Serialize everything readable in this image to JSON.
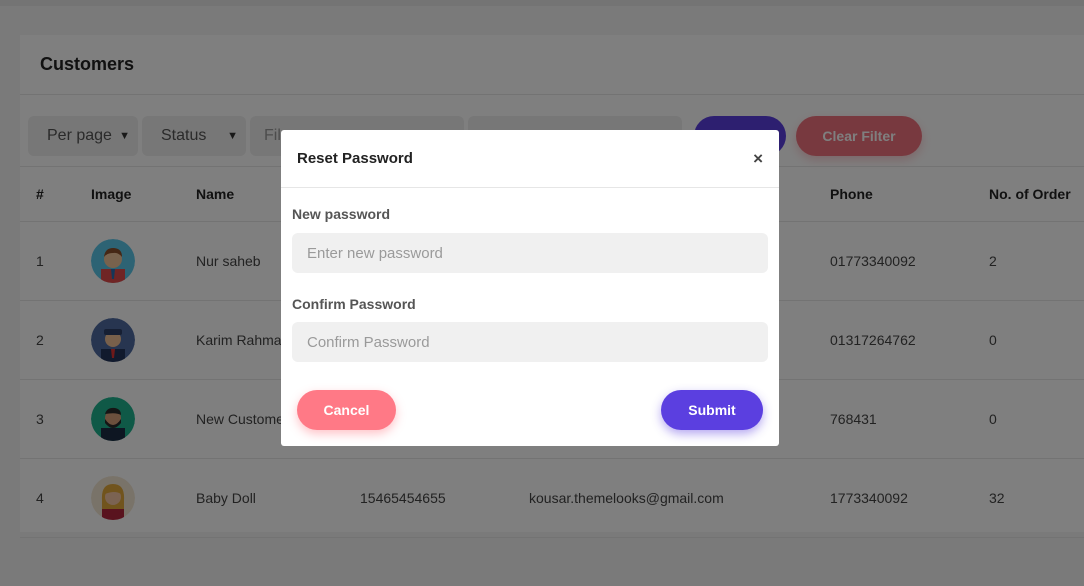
{
  "page": {
    "title": "Customers"
  },
  "filters": {
    "per_page": "Per page",
    "status": "Status",
    "filter_placeholder_partial": "Fil",
    "clear_label": "Clear Filter"
  },
  "table": {
    "headers": [
      "#",
      "Image",
      "Name",
      "Phone",
      "No. of Order"
    ],
    "rows": [
      {
        "index": "1",
        "name": "Nur saheb",
        "phone": "01773340092",
        "orders": "2",
        "avatar": "man-avatar-blue"
      },
      {
        "index": "2",
        "name": "Karim Rahman",
        "phone": "01317264762",
        "orders": "0",
        "avatar": "man-avatar-cap"
      },
      {
        "index": "3",
        "name": "New Customer",
        "phone": "768431",
        "orders": "0",
        "avatar": "man-avatar-beard"
      },
      {
        "index": "4",
        "name": "Baby Doll",
        "extra": "15465454655",
        "email": "kousar.themelooks@gmail.com",
        "phone": "1773340092",
        "orders": "32",
        "avatar": "woman-avatar"
      }
    ]
  },
  "modal": {
    "title": "Reset Password",
    "new_password_label": "New password",
    "new_password_placeholder": "Enter new password",
    "confirm_password_label": "Confirm Password",
    "confirm_password_placeholder": "Confirm Password",
    "cancel_label": "Cancel",
    "submit_label": "Submit",
    "close_glyph": "×"
  },
  "colors": {
    "primary": "#5b3fe0",
    "danger": "#ff7986"
  }
}
